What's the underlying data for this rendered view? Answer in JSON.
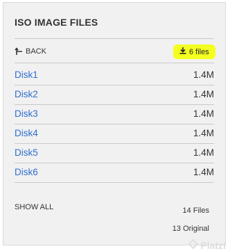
{
  "panel": {
    "title": "ISO IMAGE FILES",
    "back_label": "BACK",
    "download_label": "6 files",
    "files": [
      {
        "name": "Disk1",
        "size": "1.4M"
      },
      {
        "name": "Disk2",
        "size": "1.4M"
      },
      {
        "name": "Disk3",
        "size": "1.4M"
      },
      {
        "name": "Disk4",
        "size": "1.4M"
      },
      {
        "name": "Disk5",
        "size": "1.4M"
      },
      {
        "name": "Disk6",
        "size": "1.4M"
      }
    ],
    "show_all_label": "SHOW ALL",
    "files_count": "14 Files",
    "original_count": "13 Original"
  },
  "watermark": {
    "text": "Platzi"
  },
  "colors": {
    "highlight": "#f3ff1f",
    "link": "#2e6fcf",
    "panel_bg": "#f1f1f1"
  }
}
